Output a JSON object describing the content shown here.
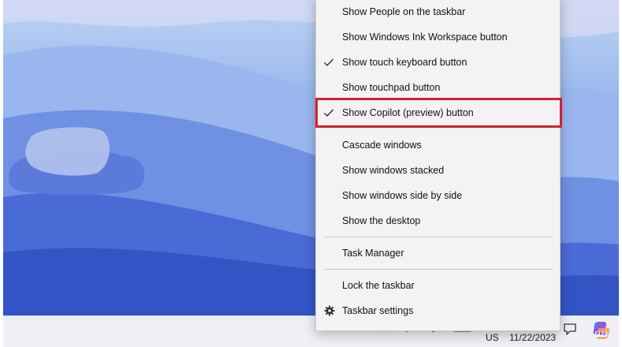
{
  "context_menu": {
    "items": [
      {
        "label": "Show People on the taskbar",
        "checked": false
      },
      {
        "label": "Show Windows Ink Workspace button",
        "checked": false
      },
      {
        "label": "Show touch keyboard button",
        "checked": true
      },
      {
        "label": "Show touchpad button",
        "checked": false
      },
      {
        "label": "Show Copilot (preview) button",
        "checked": true,
        "highlighted": true,
        "highlight_color": "#d51f2e"
      },
      {
        "label": "Cascade windows"
      },
      {
        "label": "Show windows stacked"
      },
      {
        "label": "Show windows side by side"
      },
      {
        "label": "Show the desktop"
      },
      {
        "label": "Task Manager"
      },
      {
        "label": "Lock the taskbar"
      },
      {
        "label": "Taskbar settings",
        "icon": "gear-icon"
      }
    ]
  },
  "taskbar": {
    "language": "US",
    "date": "11/22/2023",
    "copilot_badge": "PRE"
  },
  "colors": {
    "menu_background": "#f3f3f3",
    "highlight": "#d51f2e",
    "desktop_accent": "#3f5fd0"
  }
}
